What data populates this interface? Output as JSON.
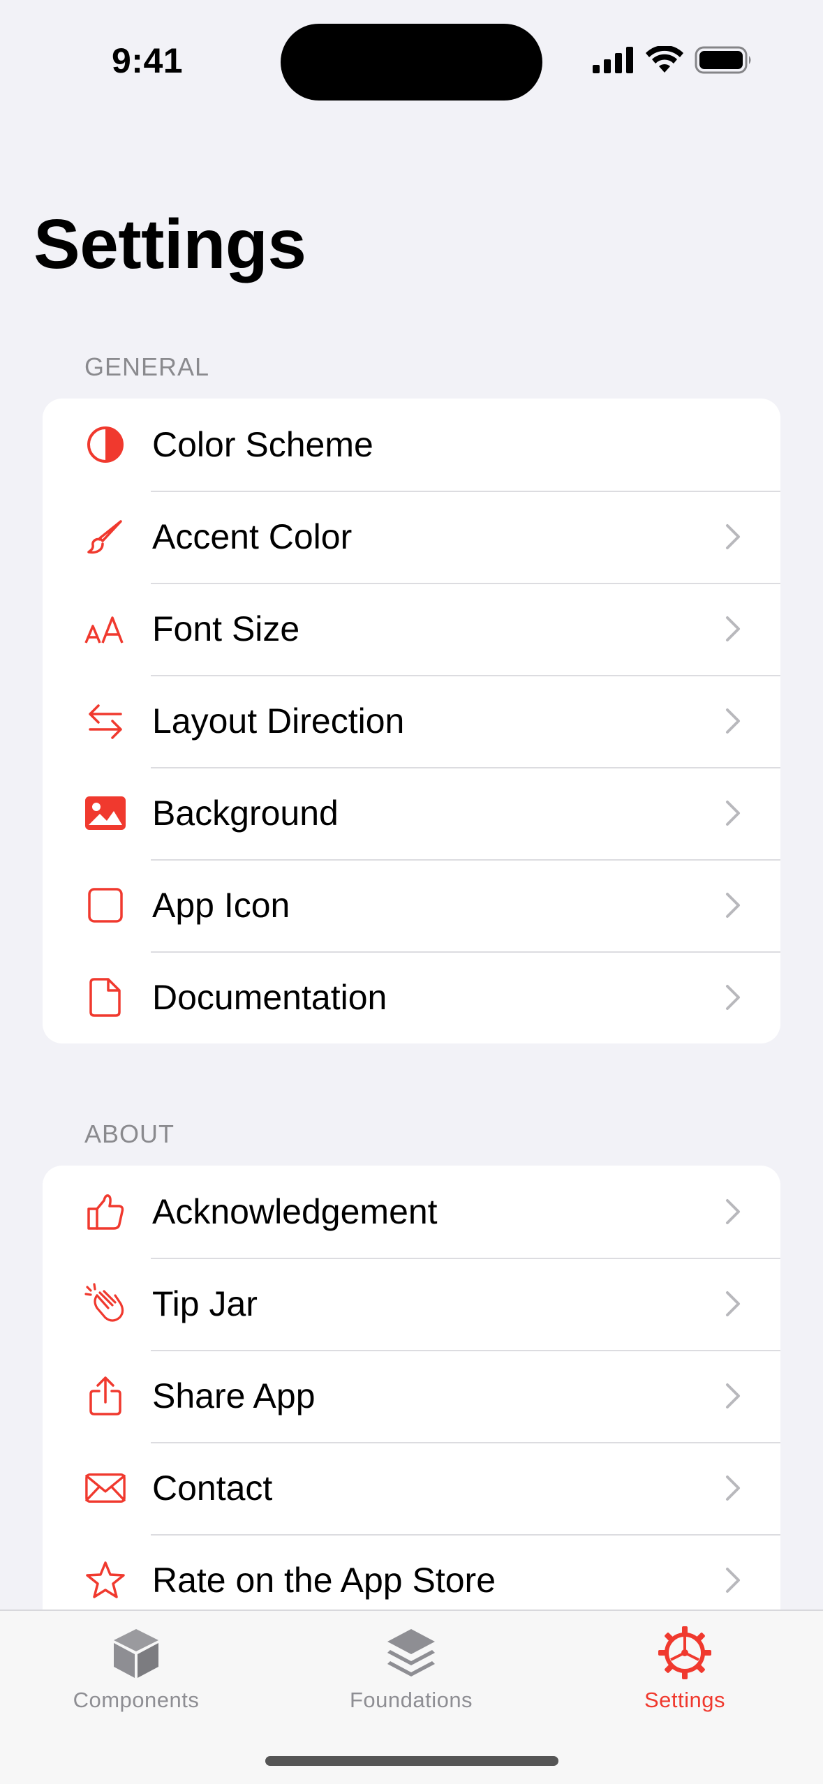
{
  "status_bar": {
    "time": "9:41"
  },
  "page": {
    "title": "Settings"
  },
  "accent": "#F0392E",
  "sections": [
    {
      "header": "GENERAL",
      "items": [
        {
          "label": "Color Scheme",
          "icon": "half-circle-icon"
        },
        {
          "label": "Accent Color",
          "icon": "paintbrush-icon"
        },
        {
          "label": "Font Size",
          "icon": "text-size-icon"
        },
        {
          "label": "Layout Direction",
          "icon": "arrows-left-right-icon"
        },
        {
          "label": "Background",
          "icon": "photo-icon"
        },
        {
          "label": "App Icon",
          "icon": "square-icon"
        },
        {
          "label": "Documentation",
          "icon": "document-icon"
        }
      ]
    },
    {
      "header": "ABOUT",
      "items": [
        {
          "label": "Acknowledgement",
          "icon": "thumbs-up-icon"
        },
        {
          "label": "Tip Jar",
          "icon": "hands-clap-icon"
        },
        {
          "label": "Share App",
          "icon": "share-icon"
        },
        {
          "label": "Contact",
          "icon": "envelope-icon"
        },
        {
          "label": "Rate on the App Store",
          "icon": "star-icon"
        }
      ]
    }
  ],
  "tab_bar": {
    "tabs": [
      {
        "label": "Components",
        "icon": "cube-icon",
        "active": false
      },
      {
        "label": "Foundations",
        "icon": "stack-icon",
        "active": false
      },
      {
        "label": "Settings",
        "icon": "gear-icon",
        "active": true
      }
    ]
  }
}
